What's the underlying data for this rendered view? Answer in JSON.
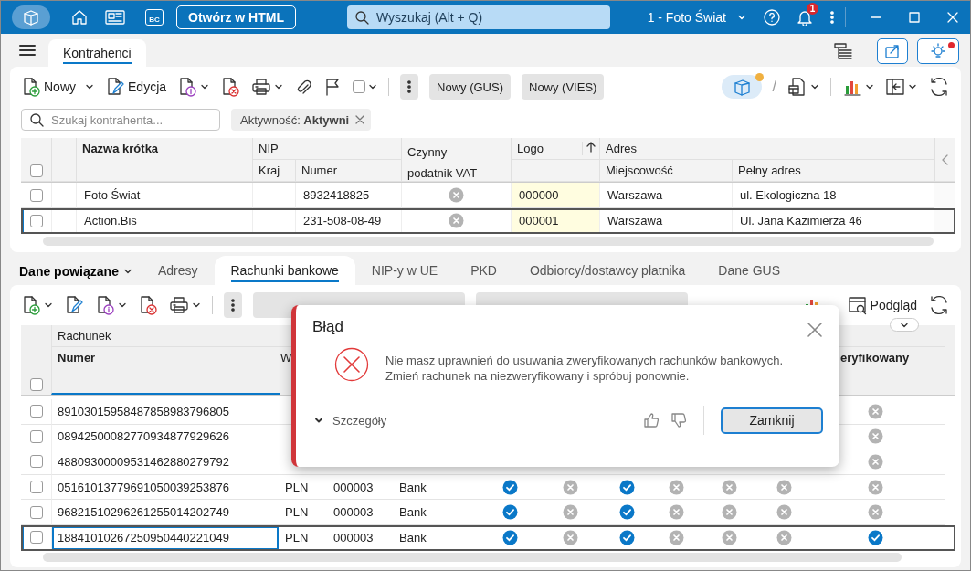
{
  "title_bar": {
    "bc_label": "BC",
    "html_button": "Otwórz w HTML",
    "search": {
      "placeholder": "Wyszukaj (Alt + Q)"
    },
    "company": "1 - Foto Świat",
    "notifications": "1"
  },
  "main_tabs": [
    {
      "label": "Kontrahenci",
      "selected": true
    }
  ],
  "toolbar": {
    "new": "Nowy",
    "edit": "Edycja",
    "checkbox": {
      "checked": false
    },
    "view_toggle": {
      "on": true
    },
    "buttons": [
      "Nowy (GUS)",
      "Nowy (VIES)"
    ],
    "separator": "/"
  },
  "filter": {
    "search": {
      "placeholder": "Szukaj kontrahenta..."
    },
    "chip": "Aktywność: **Aktywni**"
  },
  "contractors": {
    "all_checked": false,
    "headers": {
      "name": "Nazwa krótka",
      "nip": "NIP",
      "country": "Kraj",
      "number": "Numer",
      "vat": "Czynny podatnik VAT",
      "logo": "Logo",
      "address": "Adres",
      "city": "Miejscowość",
      "full_address": "Pełny adres"
    },
    "rows": [
      {
        "checked": false,
        "selected": false,
        "name": "Foto Świat",
        "nip": "8932418825",
        "vat_active": false,
        "logo": "000000",
        "city": "Warszawa",
        "address": "ul. Ekologiczna 18"
      },
      {
        "checked": false,
        "selected": true,
        "name": "Action.Bis",
        "nip": "231-508-08-49",
        "vat_active": false,
        "logo": "000001",
        "city": "Warszawa",
        "address": "Ul. Jana Kazimierza 46"
      }
    ]
  },
  "related": {
    "menu": "Dane powiązane",
    "tabs": [
      {
        "label": "Adresy",
        "selected": false
      },
      {
        "label": "Rachunki bankowe",
        "selected": true
      },
      {
        "label": "NIP-y w UE",
        "selected": false
      },
      {
        "label": "PKD",
        "selected": false
      },
      {
        "label": "Odbiorcy/dostawcy płatnika",
        "selected": false
      },
      {
        "label": "Dane GUS",
        "selected": false
      }
    ],
    "preview_button": "Podgląd",
    "table": {
      "all_checked": false,
      "expanded": false,
      "group": "Rachunek",
      "columns": [
        "Numer",
        "W",
        "eryfikowany"
      ],
      "rows": [
        {
          "checked": false,
          "selected": false,
          "number": "89103015958487858983796805",
          "verified": false
        },
        {
          "checked": false,
          "selected": false,
          "number": "08942500082770934877929626",
          "verified": false
        },
        {
          "checked": false,
          "selected": false,
          "number": "48809300009531462880279792",
          "verified": false
        },
        {
          "checked": false,
          "selected": false,
          "number": "05161013779691050039253876",
          "currency": "PLN",
          "code": "000003",
          "type": "Bank",
          "flags": [
            true,
            false,
            true,
            false,
            false,
            false
          ],
          "verified": false
        },
        {
          "checked": false,
          "selected": false,
          "number": "96821510296261255014202749",
          "currency": "PLN",
          "code": "000003",
          "type": "Bank",
          "flags": [
            true,
            false,
            true,
            false,
            false,
            false
          ],
          "verified": false
        },
        {
          "checked": false,
          "selected": true,
          "number": "18841010267250950440221049",
          "currency": "PLN",
          "code": "000003",
          "type": "Bank",
          "flags": [
            true,
            false,
            true,
            false,
            false,
            false
          ],
          "verified": true
        }
      ]
    }
  },
  "dialog": {
    "title": "Błąd",
    "message_lines": [
      "Nie masz uprawnień do usuwania zweryfikowanych rachunków bankowych.",
      "Zmień rachunek na niezweryfikowany i spróbuj ponownie."
    ],
    "details": "Szczegóły",
    "details_expanded": false,
    "close_button": "Zamknij"
  }
}
